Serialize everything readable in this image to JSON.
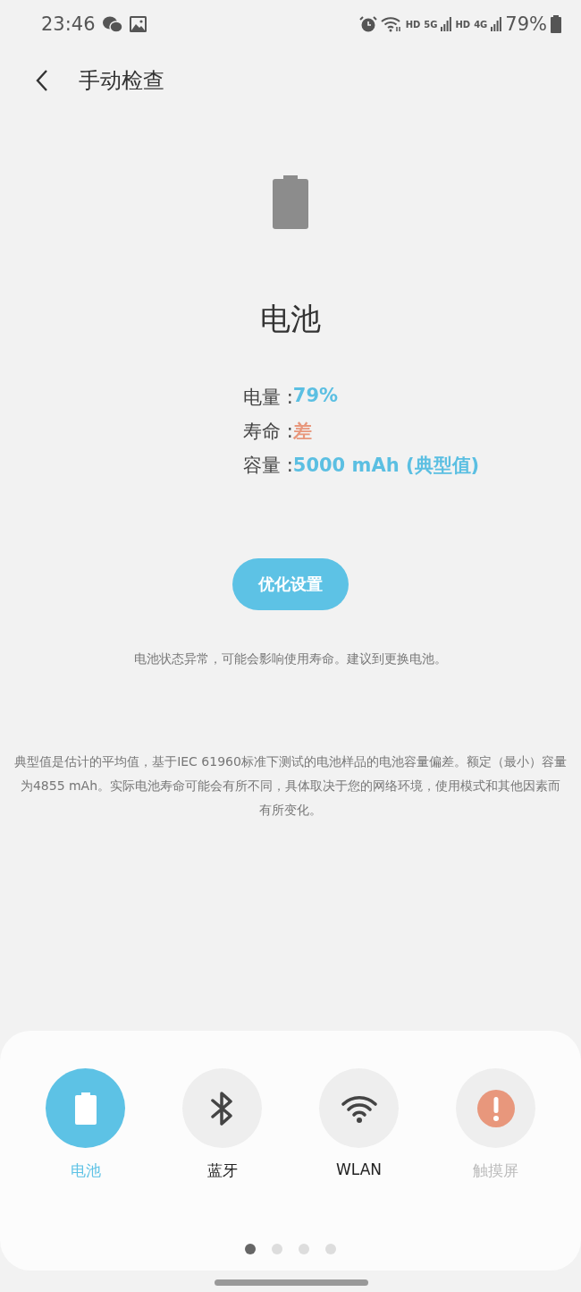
{
  "status_bar": {
    "time": "23:46",
    "network_labels": [
      "HD",
      "5G",
      "HD",
      "4G"
    ],
    "battery_text": "79%"
  },
  "header": {
    "title": "手动检查"
  },
  "test": {
    "title": "电池",
    "details": [
      {
        "label": "电量 : ",
        "value": "79%",
        "color": "#5bbfe2"
      },
      {
        "label": "寿命 : ",
        "value": "差",
        "color": "#e8977c"
      },
      {
        "label": "容量 : ",
        "value": "5000 mAh (典型值)",
        "color": "#5bbfe2"
      }
    ],
    "button": "优化设置",
    "message": "电池状态异常，可能会影响使用寿命。建议到更换电池。",
    "disclaimer": "典型值是估计的平均值，基于IEC 61960标准下测试的电池样品的电池容量偏差。额定（最小）容量为4855 mAh。实际电池寿命可能会有所不同，具体取决于您的网络环境，使用模式和其他因素而有所变化。"
  },
  "categories": [
    {
      "kind": "battery",
      "label": "电池",
      "selected": true,
      "disabled": false
    },
    {
      "kind": "bluetooth",
      "label": "蓝牙",
      "selected": false,
      "disabled": false
    },
    {
      "kind": "wifi",
      "label": "WLAN",
      "selected": false,
      "disabled": false
    },
    {
      "kind": "warning",
      "label": "触摸屏",
      "selected": false,
      "disabled": true
    }
  ],
  "pages": [
    {
      "selected": true
    },
    {
      "selected": false
    },
    {
      "selected": false
    },
    {
      "selected": false
    }
  ]
}
